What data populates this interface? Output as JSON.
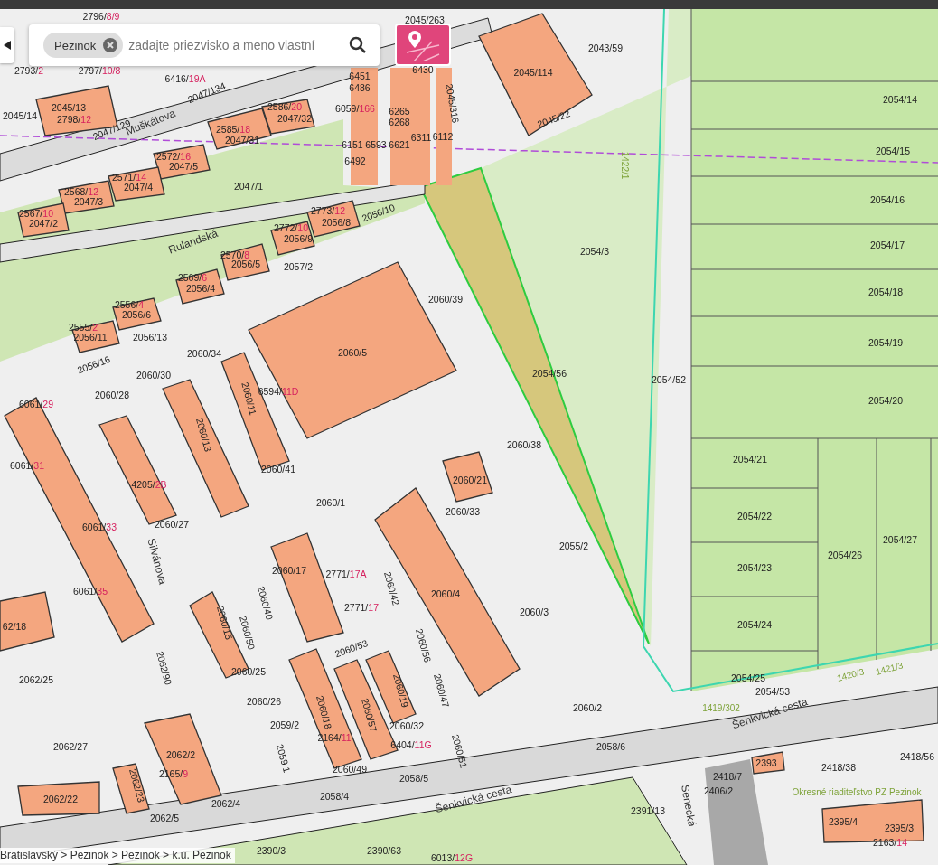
{
  "search": {
    "chip": "Pezinok",
    "placeholder": "zadajte priezvisko a meno vlastní"
  },
  "breadcrumb": "Bratislavský > Pezinok > Pezinok > k.ú. Pezinok",
  "labels": [
    {
      "kind": "parcel",
      "text": "2796/",
      "building_no": "8/9"
    },
    {
      "kind": "parcel",
      "text": "2045/263"
    },
    {
      "kind": "parcel",
      "text": "2793/",
      "building_no": "2"
    },
    {
      "kind": "parcel",
      "text": "2797/",
      "building_no": "10/8"
    },
    {
      "kind": "parcel",
      "text": "6416/",
      "building_no": "19A"
    },
    {
      "kind": "parcel",
      "text": "2045/13"
    },
    {
      "kind": "parcel",
      "text": "2798/",
      "building_no": "12"
    },
    {
      "kind": "parcel",
      "text": "2045/14"
    },
    {
      "kind": "parcel",
      "text": "2047/134"
    },
    {
      "kind": "parcel",
      "text": "2047/129"
    },
    {
      "kind": "street",
      "text": "Muškátova"
    },
    {
      "kind": "parcel",
      "text": "2586/",
      "building_no": "20"
    },
    {
      "kind": "parcel",
      "text": "2047/32"
    },
    {
      "kind": "parcel",
      "text": "2585/",
      "building_no": "18"
    },
    {
      "kind": "parcel",
      "text": "2047/31"
    },
    {
      "kind": "parcel",
      "text": "2572/",
      "building_no": "16"
    },
    {
      "kind": "parcel",
      "text": "2047/5"
    },
    {
      "kind": "parcel",
      "text": "2571/",
      "building_no": "14"
    },
    {
      "kind": "parcel",
      "text": "2047/4"
    },
    {
      "kind": "parcel",
      "text": "2568/",
      "building_no": "12"
    },
    {
      "kind": "parcel",
      "text": "2047/3"
    },
    {
      "kind": "parcel",
      "text": "2567/",
      "building_no": "10"
    },
    {
      "kind": "parcel",
      "text": "2047/2"
    },
    {
      "kind": "parcel",
      "text": "2047/1"
    },
    {
      "kind": "parcel",
      "text": "6451"
    },
    {
      "kind": "parcel",
      "text": "6486"
    },
    {
      "kind": "parcel",
      "text": "6059/",
      "building_no": "166"
    },
    {
      "kind": "parcel",
      "text": "6265"
    },
    {
      "kind": "parcel",
      "text": "6268"
    },
    {
      "kind": "parcel",
      "text": "6151"
    },
    {
      "kind": "parcel",
      "text": "6593"
    },
    {
      "kind": "parcel",
      "text": "6621"
    },
    {
      "kind": "parcel",
      "text": "6311"
    },
    {
      "kind": "parcel",
      "text": "6112"
    },
    {
      "kind": "parcel",
      "text": "6492"
    },
    {
      "kind": "parcel",
      "text": "6430"
    },
    {
      "kind": "parcel",
      "text": "2043/59"
    },
    {
      "kind": "parcel",
      "text": "2045/114"
    },
    {
      "kind": "parcel",
      "text": "2045/316"
    },
    {
      "kind": "parcel",
      "text": "2045/22"
    },
    {
      "kind": "parcel",
      "text": "2054/14"
    },
    {
      "kind": "parcel",
      "text": "2054/15"
    },
    {
      "kind": "parcel",
      "text": "2054/16"
    },
    {
      "kind": "parcel",
      "text": "2054/17"
    },
    {
      "kind": "parcel",
      "text": "2054/18"
    },
    {
      "kind": "parcel",
      "text": "2054/19"
    },
    {
      "kind": "parcel",
      "text": "2054/20"
    },
    {
      "kind": "parcel",
      "text": "2054/21"
    },
    {
      "kind": "parcel",
      "text": "2054/22"
    },
    {
      "kind": "parcel",
      "text": "2054/23"
    },
    {
      "kind": "parcel",
      "text": "2054/24"
    },
    {
      "kind": "parcel",
      "text": "2054/25"
    },
    {
      "kind": "parcel",
      "text": "2054/26"
    },
    {
      "kind": "parcel",
      "text": "2054/27"
    },
    {
      "kind": "parcel",
      "text": "2054/53"
    },
    {
      "kind": "parcel",
      "text": "2054/3"
    },
    {
      "kind": "parcel",
      "text": "2054/56"
    },
    {
      "kind": "parcel",
      "text": "2054/52"
    },
    {
      "kind": "parcel",
      "text": "2773/",
      "building_no": "12"
    },
    {
      "kind": "parcel",
      "text": "2056/8"
    },
    {
      "kind": "parcel",
      "text": "2056/10"
    },
    {
      "kind": "parcel",
      "text": "2772/",
      "building_no": "10"
    },
    {
      "kind": "parcel",
      "text": "2056/9"
    },
    {
      "kind": "parcel",
      "text": "2570/",
      "building_no": "8"
    },
    {
      "kind": "parcel",
      "text": "2056/5"
    },
    {
      "kind": "parcel",
      "text": "2057/2"
    },
    {
      "kind": "parcel",
      "text": "2569/",
      "building_no": "6"
    },
    {
      "kind": "parcel",
      "text": "2056/4"
    },
    {
      "kind": "street",
      "text": "Rulandská"
    },
    {
      "kind": "parcel",
      "text": "2556/",
      "building_no": "4"
    },
    {
      "kind": "parcel",
      "text": "2056/6"
    },
    {
      "kind": "parcel",
      "text": "2555/",
      "building_no": "2"
    },
    {
      "kind": "parcel",
      "text": "2056/11"
    },
    {
      "kind": "parcel",
      "text": "2056/13"
    },
    {
      "kind": "parcel",
      "text": "2056/16"
    },
    {
      "kind": "parcel",
      "text": "2060/39"
    },
    {
      "kind": "parcel",
      "text": "2060/5"
    },
    {
      "kind": "parcel",
      "text": "2060/34"
    },
    {
      "kind": "parcel",
      "text": "2060/30"
    },
    {
      "kind": "parcel",
      "text": "2060/28"
    },
    {
      "kind": "parcel",
      "text": "6061/",
      "building_no": "29"
    },
    {
      "kind": "parcel",
      "text": "6594/",
      "building_no": "11D"
    },
    {
      "kind": "parcel",
      "text": "2060/11"
    },
    {
      "kind": "parcel",
      "text": "2060/13"
    },
    {
      "kind": "parcel",
      "text": "2060/41"
    },
    {
      "kind": "parcel",
      "text": "2060/38"
    },
    {
      "kind": "parcel",
      "text": "2060/21"
    },
    {
      "kind": "parcel",
      "text": "2060/33"
    },
    {
      "kind": "parcel",
      "text": "2060/1"
    },
    {
      "kind": "parcel",
      "text": "2060/27"
    },
    {
      "kind": "parcel",
      "text": "4205/",
      "building_no": "2B"
    },
    {
      "kind": "parcel",
      "text": "6061/",
      "building_no": "31"
    },
    {
      "kind": "parcel",
      "text": "6061/",
      "building_no": "33"
    },
    {
      "kind": "parcel",
      "text": "6061/",
      "building_no": "35"
    },
    {
      "kind": "street",
      "text": "Silvánova"
    },
    {
      "kind": "parcel",
      "text": "2055/2"
    },
    {
      "kind": "parcel",
      "text": "2060/17"
    },
    {
      "kind": "parcel",
      "text": "2771/",
      "building_no": "17A"
    },
    {
      "kind": "parcel",
      "text": "2060/42"
    },
    {
      "kind": "parcel",
      "text": "2771/",
      "building_no": "17"
    },
    {
      "kind": "parcel",
      "text": "2060/4"
    },
    {
      "kind": "parcel",
      "text": "2060/3"
    },
    {
      "kind": "parcel",
      "text": "2060/40"
    },
    {
      "kind": "parcel",
      "text": "2060/15"
    },
    {
      "kind": "parcel",
      "text": "2060/50"
    },
    {
      "kind": "parcel",
      "text": "62/18"
    },
    {
      "kind": "parcel",
      "text": "2062/25"
    },
    {
      "kind": "parcel",
      "text": "2062/90"
    },
    {
      "kind": "parcel",
      "text": "2060/53"
    },
    {
      "kind": "parcel",
      "text": "2060/56"
    },
    {
      "kind": "parcel",
      "text": "2060/25"
    },
    {
      "kind": "parcel",
      "text": "2060/26"
    },
    {
      "kind": "parcel",
      "text": "2060/18"
    },
    {
      "kind": "parcel",
      "text": "2060/57"
    },
    {
      "kind": "parcel",
      "text": "2060/19"
    },
    {
      "kind": "parcel",
      "text": "2060/47"
    },
    {
      "kind": "parcel",
      "text": "2060/2"
    },
    {
      "kind": "parcel",
      "text": "2059/2"
    },
    {
      "kind": "parcel",
      "text": "2060/32"
    },
    {
      "kind": "parcel",
      "text": "2062/27"
    },
    {
      "kind": "parcel",
      "text": "2060/51"
    },
    {
      "kind": "parcel",
      "text": "2164/",
      "building_no": "11"
    },
    {
      "kind": "parcel",
      "text": "6404/",
      "building_no": "11G"
    },
    {
      "kind": "parcel",
      "text": "2062/2"
    },
    {
      "kind": "parcel",
      "text": "2165/",
      "building_no": "9"
    },
    {
      "kind": "parcel",
      "text": "2059/1"
    },
    {
      "kind": "parcel",
      "text": "2060/49"
    },
    {
      "kind": "parcel",
      "text": "2058/5"
    },
    {
      "kind": "parcel",
      "text": "2062/22"
    },
    {
      "kind": "parcel",
      "text": "2062/23"
    },
    {
      "kind": "parcel",
      "text": "2062/4"
    },
    {
      "kind": "parcel",
      "text": "2058/4"
    },
    {
      "kind": "parcel",
      "text": "2062/5"
    },
    {
      "kind": "parcel",
      "text": "2058/6"
    },
    {
      "kind": "street",
      "text": "Šenkvická cesta"
    },
    {
      "kind": "street",
      "text": "Šenkvická cesta"
    },
    {
      "kind": "former",
      "text": "1419/302"
    },
    {
      "kind": "former",
      "text": "1420/3"
    },
    {
      "kind": "former",
      "text": "1421/3"
    },
    {
      "kind": "parcel",
      "text": "2393"
    },
    {
      "kind": "parcel",
      "text": "2418/7"
    },
    {
      "kind": "parcel",
      "text": "2418/38"
    },
    {
      "kind": "parcel",
      "text": "2418/56"
    },
    {
      "kind": "street",
      "text": "Senecká"
    },
    {
      "kind": "parcel",
      "text": "2406/2"
    },
    {
      "kind": "parcel",
      "text": "2391/13"
    },
    {
      "kind": "parcel",
      "text": "2395/4"
    },
    {
      "kind": "parcel",
      "text": "2395/3"
    },
    {
      "kind": "parcel",
      "text": "2163/",
      "building_no": "14"
    },
    {
      "kind": "parcel",
      "text": "2390/63"
    },
    {
      "kind": "parcel",
      "text": "2390/3"
    },
    {
      "kind": "parcel",
      "text": "6013/",
      "building_no": "12G"
    },
    {
      "kind": "former",
      "text": "1422/1"
    },
    {
      "kind": "former",
      "text": "Okresné riaditeľstvo PZ Pezinok"
    }
  ]
}
